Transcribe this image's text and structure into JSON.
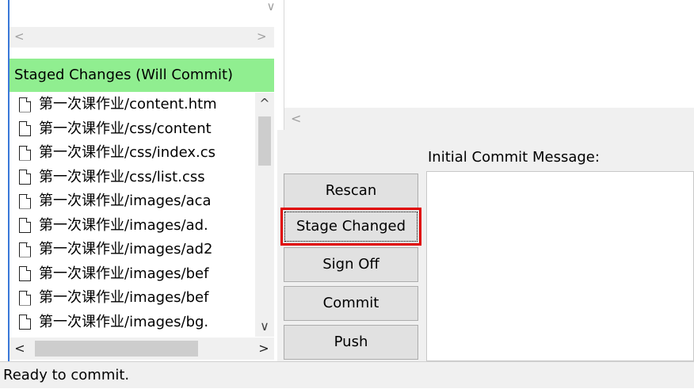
{
  "unstaged": {
    "scroll_down_glyph": "∨",
    "hscroll_left_glyph": "<",
    "hscroll_right_glyph": ">"
  },
  "staged": {
    "header": "Staged Changes (Will Commit)",
    "files": [
      "第一次课作业/content.htm",
      "第一次课作业/css/content",
      "第一次课作业/css/index.cs",
      "第一次课作业/css/list.css",
      "第一次课作业/images/aca",
      "第一次课作业/images/ad.",
      "第一次课作业/images/ad2",
      "第一次课作业/images/bef",
      "第一次课作业/images/bef",
      "第一次课作业/images/bg."
    ],
    "file_icon": "file-document-icon",
    "vscroll_up_glyph": "^",
    "vscroll_down_glyph": "∨",
    "hscroll_left_glyph": "<",
    "hscroll_right_glyph": ">"
  },
  "right_pane": {
    "hscroll_left_glyph": "<"
  },
  "commit": {
    "message_label": "Initial Commit Message:",
    "message_value": "",
    "buttons": {
      "rescan": "Rescan",
      "stage_changed": "Stage Changed",
      "sign_off": "Sign Off",
      "commit": "Commit",
      "push": "Push"
    }
  },
  "status": {
    "text": "Ready to commit."
  },
  "colors": {
    "staged_header_bg": "#90ee90",
    "highlight_border": "#e00000",
    "selection_edge": "#3a78d8"
  }
}
